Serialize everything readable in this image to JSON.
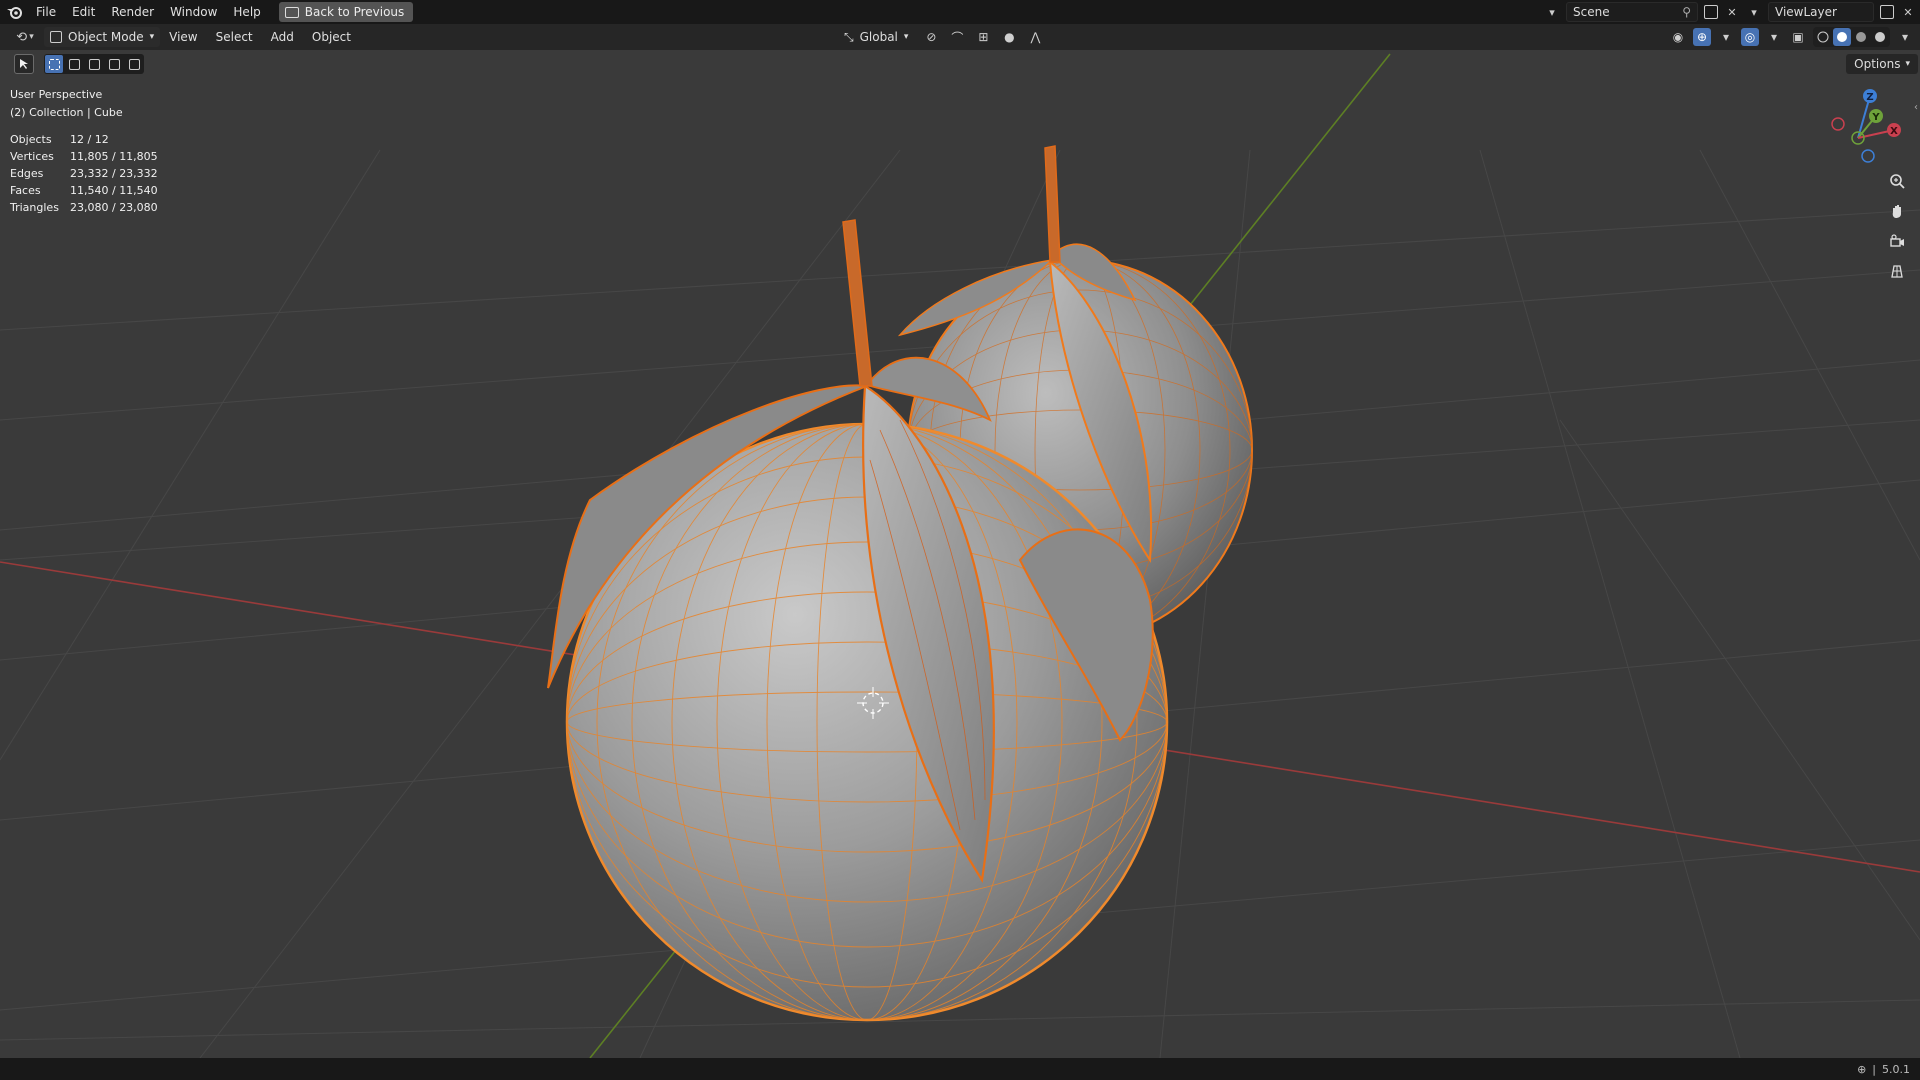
{
  "topbar": {
    "menu": [
      "File",
      "Edit",
      "Render",
      "Window",
      "Help"
    ],
    "back_label": "Back to Previous",
    "scene_name": "Scene",
    "view_layer": "ViewLayer"
  },
  "header": {
    "mode_label": "Object Mode",
    "menus": [
      "View",
      "Select",
      "Add",
      "Object"
    ],
    "orientation_label": "Global"
  },
  "options_label": "Options",
  "viewport_info": {
    "perspective": "User Perspective",
    "collection": "(2) Collection | Cube"
  },
  "stats": [
    {
      "label": "Objects",
      "value": "12 / 12"
    },
    {
      "label": "Vertices",
      "value": "11,805 / 11,805"
    },
    {
      "label": "Edges",
      "value": "23,332 / 23,332"
    },
    {
      "label": "Faces",
      "value": "11,540 / 11,540"
    },
    {
      "label": "Triangles",
      "value": "23,080 / 23,080"
    }
  ],
  "gizmo": {
    "x": "X",
    "y": "Y",
    "z": "Z"
  },
  "version": "5.0.1",
  "colors": {
    "selection_orange": "#f07a1c",
    "active_blue": "#4772b3",
    "axis_red": "#b33b3b",
    "axis_green": "#6c9a2a"
  }
}
